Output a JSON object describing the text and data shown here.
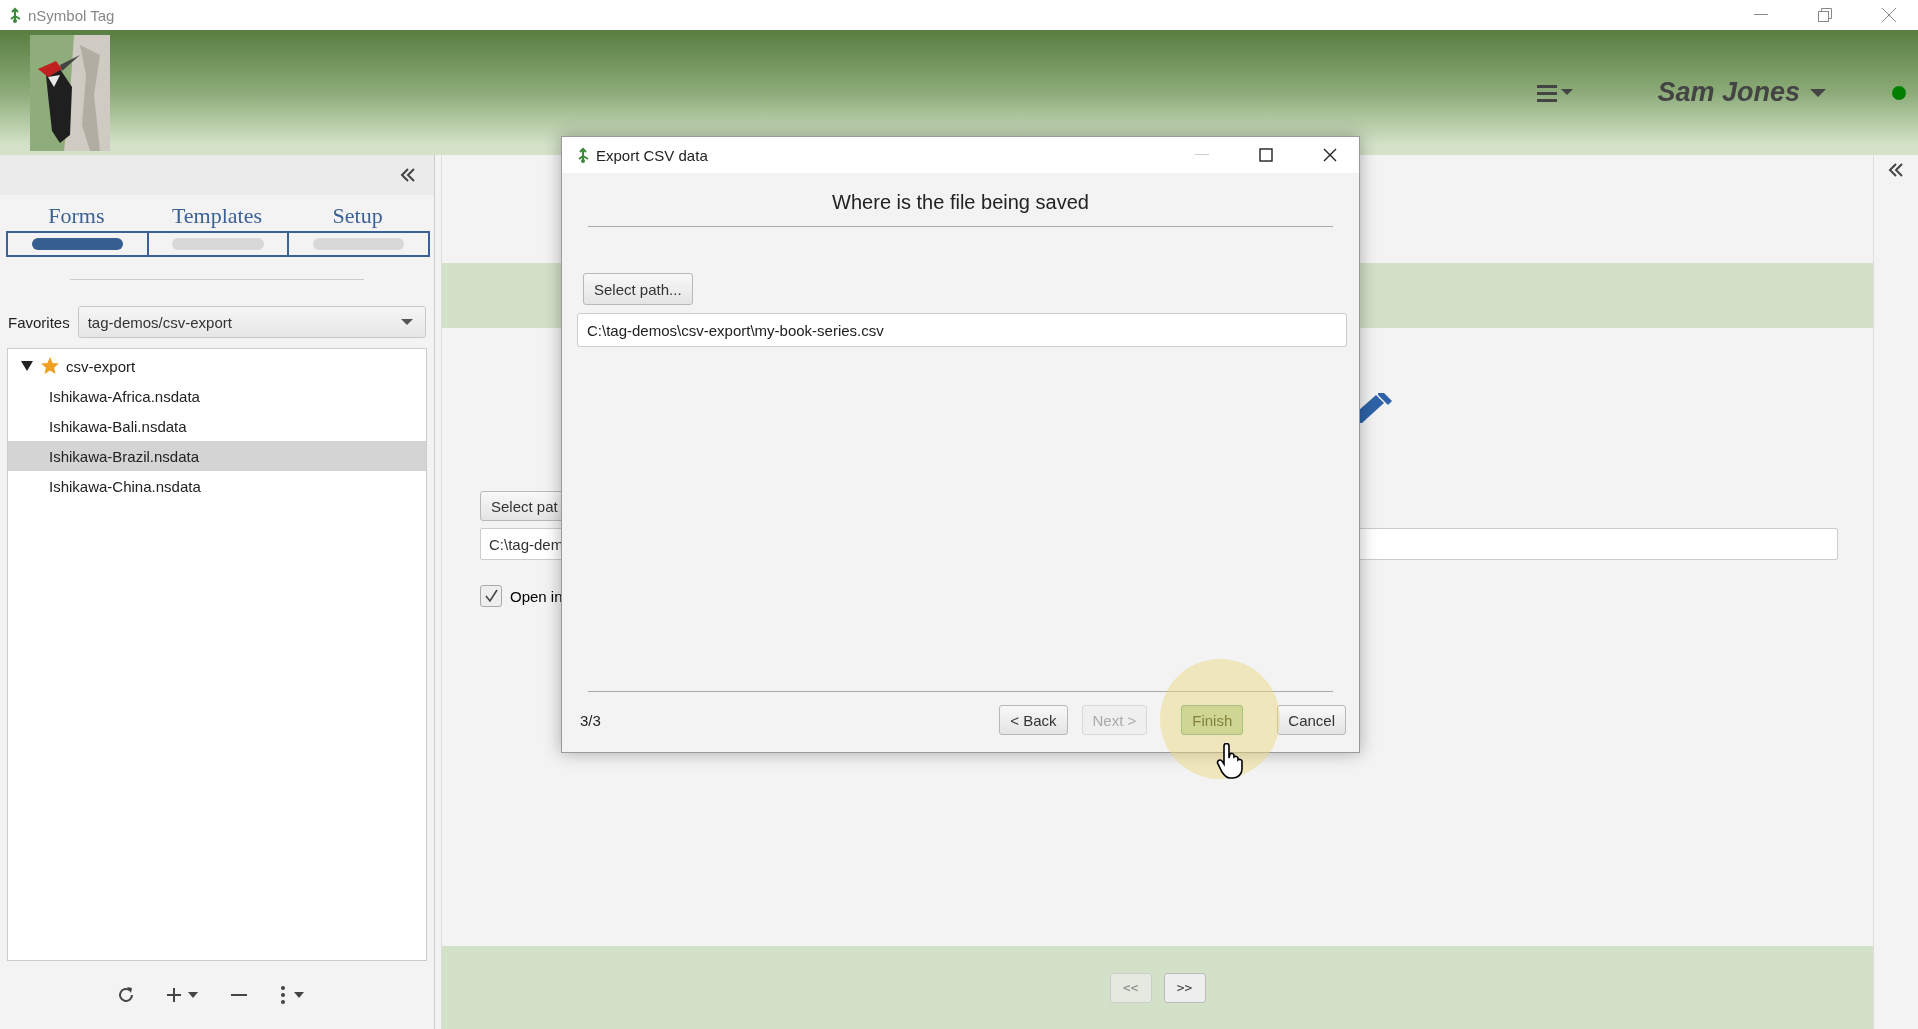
{
  "window": {
    "title": "nSymbol Tag"
  },
  "header": {
    "user": "Sam Jones",
    "online": true
  },
  "sidebar": {
    "tabs": [
      {
        "label": "Forms",
        "selected": true
      },
      {
        "label": "Templates",
        "selected": false
      },
      {
        "label": "Setup",
        "selected": false
      }
    ],
    "favorites": {
      "label": "Favorites",
      "value": "tag-demos/csv-export"
    },
    "tree": [
      {
        "label": "csv-export",
        "starred": true,
        "expanded": true,
        "selected": false,
        "children": [
          {
            "label": "Ishikawa-Africa.nsdata",
            "selected": false
          },
          {
            "label": "Ishikawa-Bali.nsdata",
            "selected": false
          },
          {
            "label": "Ishikawa-Brazil.nsdata",
            "selected": true
          },
          {
            "label": "Ishikawa-China.nsdata",
            "selected": false
          }
        ]
      }
    ]
  },
  "background": {
    "select_button": "Select pat",
    "path_field": "C:\\tag-dem",
    "checkbox": {
      "label": "Open in",
      "checked": true
    },
    "nav_buttons": [
      {
        "label": "<<",
        "disabled": true
      },
      {
        "label": ">>",
        "disabled": false
      }
    ]
  },
  "dialog": {
    "title": "Export CSV data",
    "heading": "Where is the file being saved",
    "select_button": "Select path...",
    "path": "C:\\tag-demos\\csv-export\\my-book-series.csv",
    "step": "3/3",
    "buttons": [
      {
        "label": "< Back",
        "disabled": false,
        "pressed": false
      },
      {
        "label": "Next >",
        "disabled": true,
        "pressed": false
      },
      {
        "label": "Finish",
        "disabled": false,
        "pressed": true
      },
      {
        "label": "Cancel",
        "disabled": false,
        "pressed": false
      }
    ]
  }
}
